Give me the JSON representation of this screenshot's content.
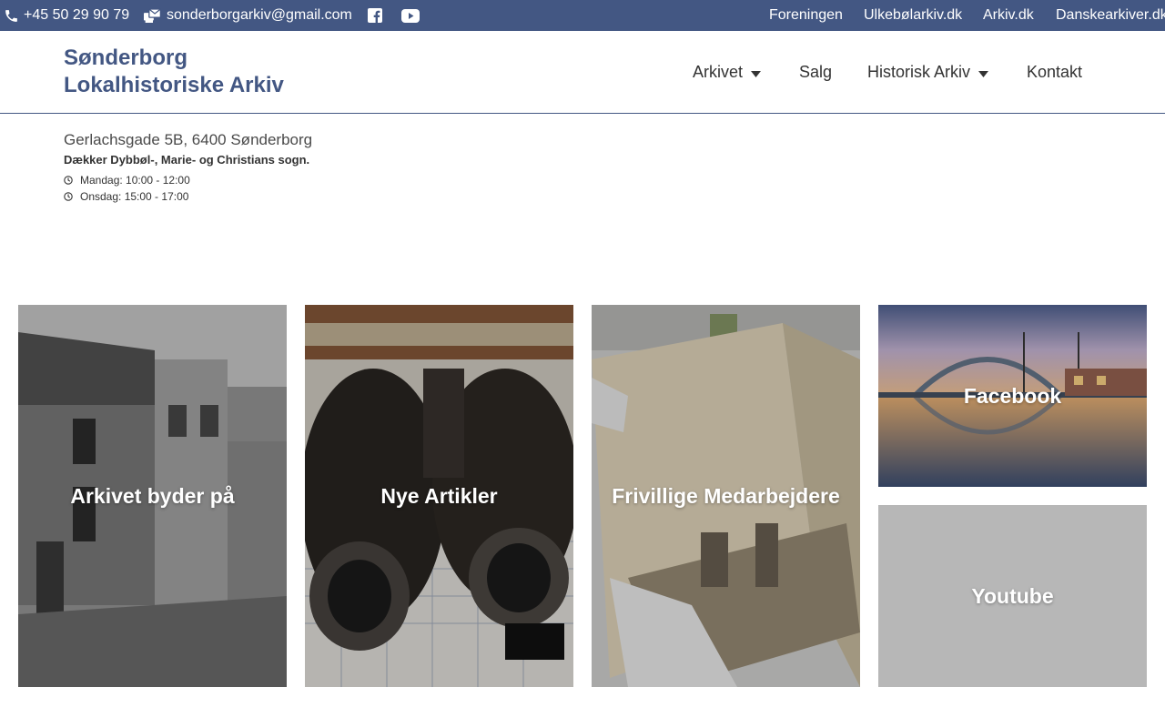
{
  "topbar": {
    "phone": "+45 50 29 90 79",
    "email": "sonderborgarkiv@gmail.com",
    "phone_icon": "phone-icon",
    "email_icon": "mail-bulk-icon",
    "social_icons": [
      "facebook-square-icon",
      "youtube-icon"
    ],
    "links": [
      "Foreningen",
      "Ulkebølarkiv.dk",
      "Arkiv.dk",
      "Danskearkiver.dk"
    ],
    "background": "#435783"
  },
  "header": {
    "logo_line1": "Sønderborg",
    "logo_line2": "Lokalhistoriske Arkiv",
    "logo_color": "#435783",
    "nav": [
      {
        "label": "Arkivet",
        "has_dropdown": true
      },
      {
        "label": "Salg",
        "has_dropdown": false
      },
      {
        "label": "Historisk Arkiv",
        "has_dropdown": true
      },
      {
        "label": "Kontakt",
        "has_dropdown": false
      }
    ]
  },
  "info": {
    "address": "Gerlachsgade 5B, 6400 Sønderborg",
    "parishes": "Dækker Dybbøl-, Marie- og Christians sogn.",
    "hours": [
      "Mandag: 10:00 - 12:00",
      "Onsdag: 15:00 - 17:00"
    ],
    "hours_icon": "clock-icon"
  },
  "cards": [
    {
      "label": "Arkivet byder på"
    },
    {
      "label": "Nye Artikler"
    },
    {
      "label": "Frivillige Medarbejdere"
    },
    {
      "label": "Facebook"
    },
    {
      "label": "Youtube"
    }
  ]
}
